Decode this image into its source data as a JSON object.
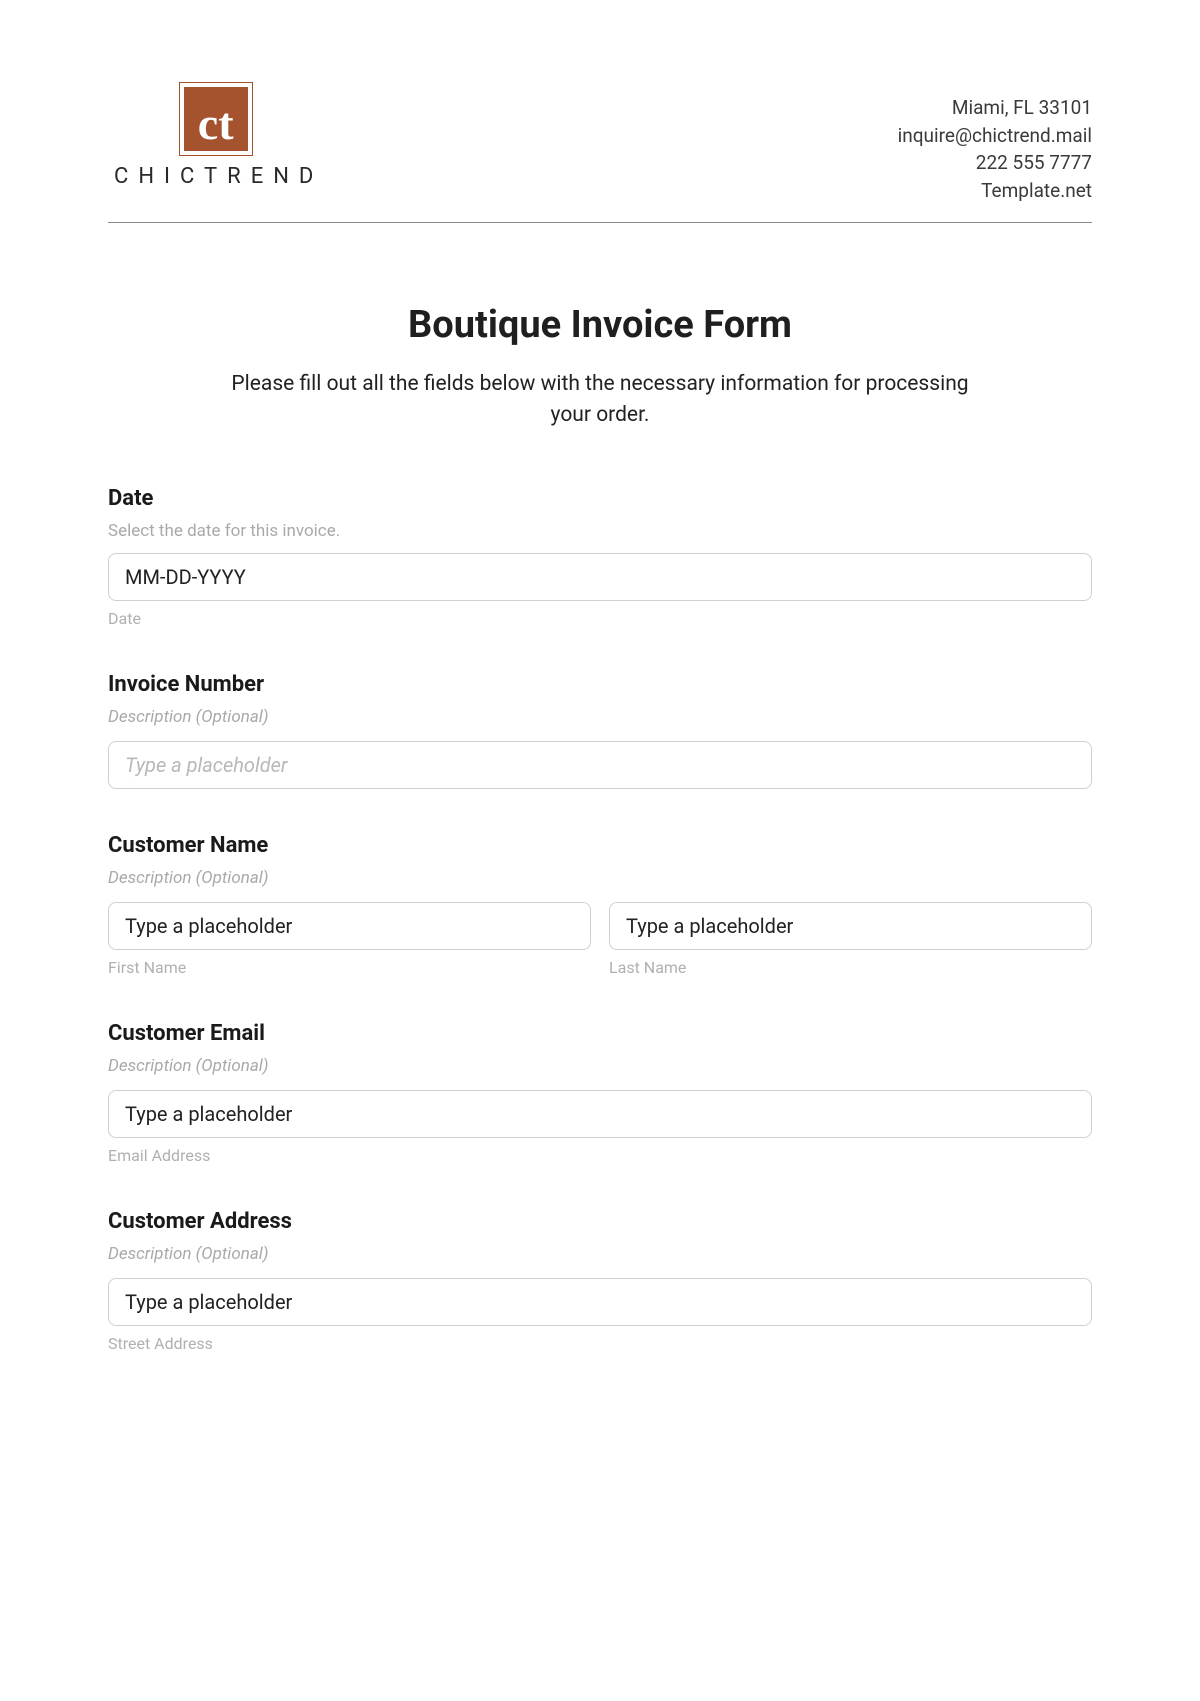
{
  "brand": {
    "logo_text": "ct",
    "name": "CHICTREND"
  },
  "contact": {
    "line1": "Miami, FL 33101",
    "line2": "inquire@chictrend.mail",
    "line3": "222 555 7777",
    "line4": "Template.net"
  },
  "page": {
    "title": "Boutique Invoice Form",
    "subtitle": "Please fill out all the fields below with the necessary information for processing your order."
  },
  "fields": {
    "date": {
      "label": "Date",
      "desc": "Select the date for this invoice.",
      "placeholder": "MM-DD-YYYY",
      "sub": "Date"
    },
    "invoice_number": {
      "label": "Invoice Number",
      "desc": "Description (Optional)",
      "placeholder": "Type a placeholder"
    },
    "customer_name": {
      "label": "Customer Name",
      "desc": "Description (Optional)",
      "first_placeholder": "Type a placeholder",
      "last_placeholder": "Type a placeholder",
      "first_sub": "First Name",
      "last_sub": "Last Name"
    },
    "customer_email": {
      "label": "Customer Email",
      "desc": "Description (Optional)",
      "placeholder": "Type a placeholder",
      "sub": "Email Address"
    },
    "customer_address": {
      "label": "Customer Address",
      "desc": "Description (Optional)",
      "placeholder": "Type a placeholder",
      "sub": "Street Address"
    }
  }
}
